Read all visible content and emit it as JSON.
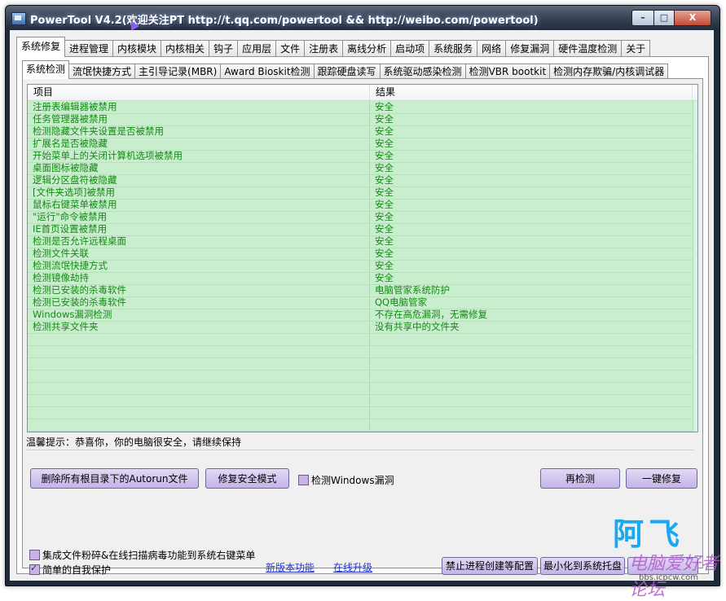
{
  "window": {
    "title": "PowerTool V4.2(欢迎关注PT http://t.qq.com/powertool && http://weibo.com/powertool)",
    "controls": {
      "minimize": "–",
      "maximize": "□",
      "close": "X"
    }
  },
  "main_tabs": [
    "系统修复",
    "进程管理",
    "内核模块",
    "内核相关",
    "钩子",
    "应用层",
    "文件",
    "注册表",
    "离线分析",
    "启动项",
    "系统服务",
    "网络",
    "修复漏洞",
    "硬件温度检测",
    "关于"
  ],
  "sub_tabs": [
    "系统检测",
    "流氓快捷方式",
    "主引导记录(MBR)",
    "Award Bioskit检测",
    "跟踪硬盘读写",
    "系统驱动感染检测",
    "检测VBR bootkit",
    "检测内存欺骗/内核调试器"
  ],
  "table": {
    "columns": [
      "项目",
      "结果"
    ],
    "rows": [
      [
        "注册表编辑器被禁用",
        "安全"
      ],
      [
        "任务管理器被禁用",
        "安全"
      ],
      [
        "检测隐藏文件夹设置是否被禁用",
        "安全"
      ],
      [
        "扩展名是否被隐藏",
        "安全"
      ],
      [
        "开始菜单上的关闭计算机选项被禁用",
        "安全"
      ],
      [
        "桌面图标被隐藏",
        "安全"
      ],
      [
        "逻辑分区盘符被隐藏",
        "安全"
      ],
      [
        "[文件夹选项]被禁用",
        "安全"
      ],
      [
        "鼠标右键菜单被禁用",
        "安全"
      ],
      [
        "\"运行\"命令被禁用",
        "安全"
      ],
      [
        "IE首页设置被禁用",
        "安全"
      ],
      [
        "检测是否允许远程桌面",
        "安全"
      ],
      [
        "检测文件关联",
        "安全"
      ],
      [
        "检测流氓快捷方式",
        "安全"
      ],
      [
        "检测镜像劫持",
        "安全"
      ],
      [
        "检测已安装的杀毒软件",
        "电脑管家系统防护"
      ],
      [
        "检测已安装的杀毒软件",
        "QQ电脑管家"
      ],
      [
        "Windows漏洞检测",
        "不存在高危漏洞，无需修复"
      ],
      [
        "检测共享文件夹",
        "没有共享中的文件夹"
      ]
    ]
  },
  "tip": "温馨提示：恭喜你，你的电脑很安全，请继续保持",
  "buttons": {
    "delete_autorun": "删除所有根目录下的Autorun文件",
    "fix_safe_mode": "修复安全模式",
    "recheck": "再检测",
    "one_click_fix": "一键修复",
    "forbid_process": "禁止进程创建等配置",
    "minimize_tray": "最小化到系统托盘"
  },
  "checkboxes": {
    "check_windows_vuln": {
      "label": "检测Windows漏洞",
      "checked": false
    },
    "integrate_context": {
      "label": "集成文件粉碎&在线扫描病毒功能到系统右键菜单",
      "checked": false
    },
    "self_protect": {
      "label": "简单的自我保护",
      "checked": true
    }
  },
  "links": {
    "new_features": "新版本功能",
    "online_upgrade": "在线升级"
  },
  "brand": "阿飞",
  "watermark": {
    "line1": "电脑爱好者论坛",
    "line2": "bbs.icpcw.com"
  }
}
